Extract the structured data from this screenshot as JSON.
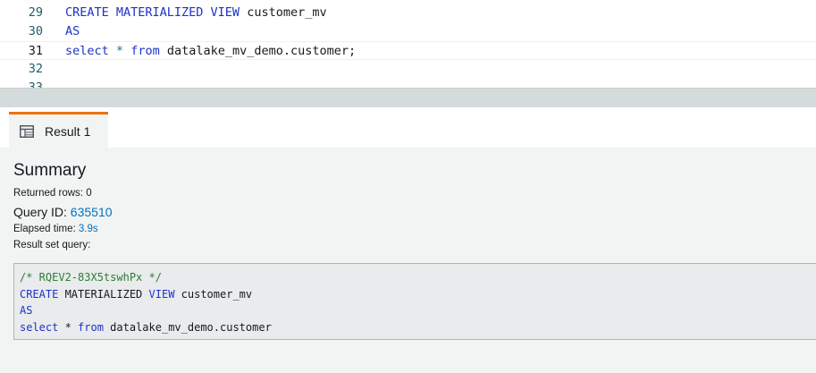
{
  "editor": {
    "lines": [
      {
        "number": "29",
        "parts": [
          {
            "text": "CREATE MATERIALIZED VIEW",
            "kind": "kw"
          },
          {
            "text": " customer_mv",
            "kind": "plain"
          }
        ]
      },
      {
        "number": "30",
        "parts": [
          {
            "text": "AS",
            "kind": "kw"
          }
        ]
      },
      {
        "number": "31",
        "parts": [
          {
            "text": "select",
            "kind": "kw"
          },
          {
            "text": " ",
            "kind": "plain"
          },
          {
            "text": "*",
            "kind": "op"
          },
          {
            "text": " ",
            "kind": "plain"
          },
          {
            "text": "from",
            "kind": "kw"
          },
          {
            "text": " datalake_mv_demo.customer;",
            "kind": "plain"
          }
        ]
      },
      {
        "number": "32",
        "parts": []
      },
      {
        "number": "33",
        "parts": []
      }
    ]
  },
  "results": {
    "tab_label": "Result 1",
    "summary_title": "Summary",
    "returned_rows_label": "Returned rows: ",
    "returned_rows_value": "0",
    "query_id_label": "Query ID: ",
    "query_id_value": "635510",
    "elapsed_label": "Elapsed time: ",
    "elapsed_value": "3.9s",
    "result_set_label": "Result set query:",
    "sql_lines": [
      {
        "parts": [
          {
            "text": "/* RQEV2-83X5tswhPx */",
            "kind": "cmt"
          }
        ]
      },
      {
        "parts": [
          {
            "text": "CREATE",
            "kind": "kw"
          },
          {
            "text": " MATERIALIZED ",
            "kind": "plain"
          },
          {
            "text": "VIEW",
            "kind": "kw"
          },
          {
            "text": " customer_mv",
            "kind": "plain"
          }
        ]
      },
      {
        "parts": [
          {
            "text": "AS",
            "kind": "kw"
          }
        ]
      },
      {
        "parts": [
          {
            "text": "select",
            "kind": "kw"
          },
          {
            "text": " * ",
            "kind": "plain"
          },
          {
            "text": "from",
            "kind": "kw"
          },
          {
            "text": " datalake_mv_demo.customer",
            "kind": "plain"
          }
        ]
      }
    ]
  },
  "colors": {
    "keyword": "#1d33c7",
    "comment": "#2e7d32",
    "link": "#0073bb",
    "tab_accent": "#ec7211"
  }
}
